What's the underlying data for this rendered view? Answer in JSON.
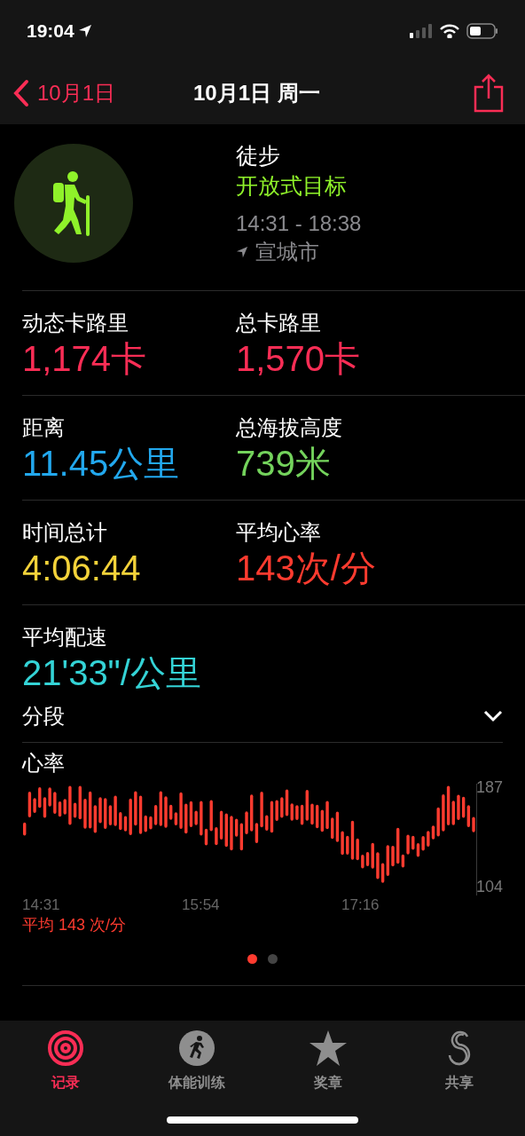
{
  "status_bar": {
    "time": "19:04"
  },
  "nav": {
    "back": "10月1日",
    "title": "10月1日 周一"
  },
  "workout": {
    "name": "徒步",
    "goal": "开放式目标",
    "time_range": "14:31 - 18:38",
    "location": "宣城市"
  },
  "metrics": [
    {
      "label": "动态卡路里",
      "value": "1,174卡",
      "color": "#fa2d55"
    },
    {
      "label": "总卡路里",
      "value": "1,570卡",
      "color": "#fa2d55"
    },
    {
      "label": "距离",
      "value": "11.45公里",
      "color": "#22a8ee"
    },
    {
      "label": "总海拔高度",
      "value": "739米",
      "color": "#74d35c"
    },
    {
      "label": "时间总计",
      "value": "4:06:44",
      "color": "#f3d23a"
    },
    {
      "label": "平均心率",
      "value": "143次/分",
      "color": "#ff3b2f"
    },
    {
      "label": "平均配速",
      "value": "21'33\"/公里",
      "color": "#34d3d6"
    }
  ],
  "segments": {
    "label": "分段",
    "expanded": false
  },
  "heart_rate": {
    "title": "心率",
    "average": "平均 143 次/分",
    "y_max": "187",
    "y_min": "104",
    "time_labels": [
      "14:31",
      "15:54",
      "17:16"
    ]
  },
  "page_dots": [
    {
      "selected": true
    },
    {
      "selected": false
    }
  ],
  "tabs": [
    {
      "kind": "rings",
      "label": "记录",
      "selected": true
    },
    {
      "kind": "workout",
      "label": "体能训练",
      "selected": false
    },
    {
      "kind": "awards",
      "label": "奖章",
      "selected": false
    },
    {
      "kind": "sharing",
      "label": "共享",
      "selected": false
    }
  ]
}
